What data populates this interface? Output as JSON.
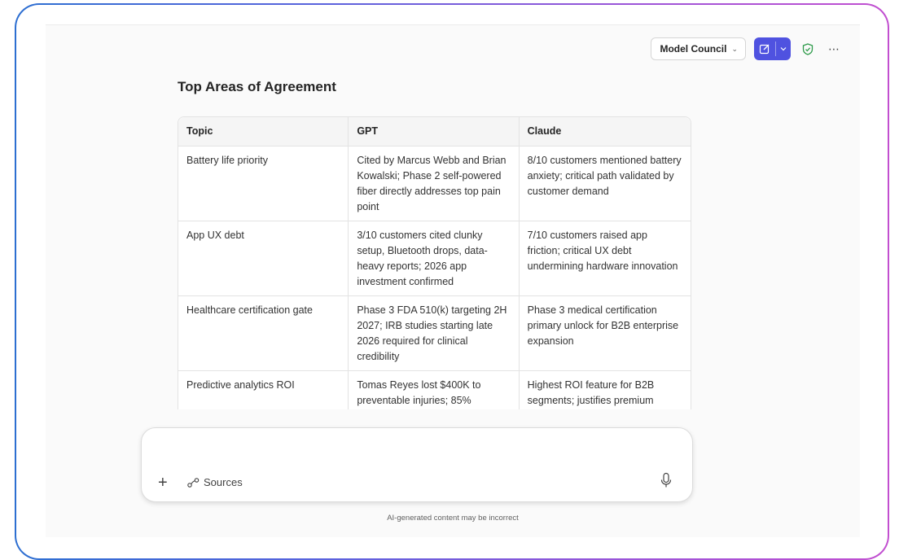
{
  "header": {
    "model_selector_label": "Model Council",
    "icons": [
      "compose-icon",
      "chevron-down-icon",
      "shield-check-icon",
      "more-icon"
    ],
    "accent_color": "#4f52e0",
    "shield_color": "#2e9b4a"
  },
  "section": {
    "title": "Top Areas of Agreement"
  },
  "table": {
    "columns": [
      "Topic",
      "GPT",
      "Claude"
    ],
    "rows": [
      {
        "topic": "Battery life priority",
        "gpt": "Cited by Marcus Webb and Brian Kowalski; Phase 2 self-powered fiber directly addresses top pain point",
        "claude": "8/10 customers mentioned battery anxiety; critical path validated by customer demand"
      },
      {
        "topic": "App UX debt",
        "gpt": "3/10 customers cited clunky setup, Bluetooth drops, data-heavy reports; 2026 app investment confirmed",
        "claude": "7/10 customers raised app friction; critical UX debt undermining hardware innovation"
      },
      {
        "topic": "Healthcare certification gate",
        "gpt": "Phase 3 FDA 510(k) targeting 2H 2027; IRB studies starting late 2026 required for clinical credibility",
        "claude": "Phase 3 medical certification primary unlock for B2B enterprise expansion"
      },
      {
        "topic": "Predictive analytics ROI",
        "gpt": "Tomas Reyes lost $400K to preventable injuries; 85%",
        "claude": "Highest ROI feature for B2B segments; justifies premium"
      }
    ]
  },
  "composer": {
    "placeholder": "",
    "value": "",
    "add_label": "+",
    "sources_label": "Sources",
    "icons": [
      "plus-icon",
      "sources-icon",
      "microphone-icon"
    ]
  },
  "footer": {
    "disclaimer": "AI-generated content may be incorrect"
  }
}
